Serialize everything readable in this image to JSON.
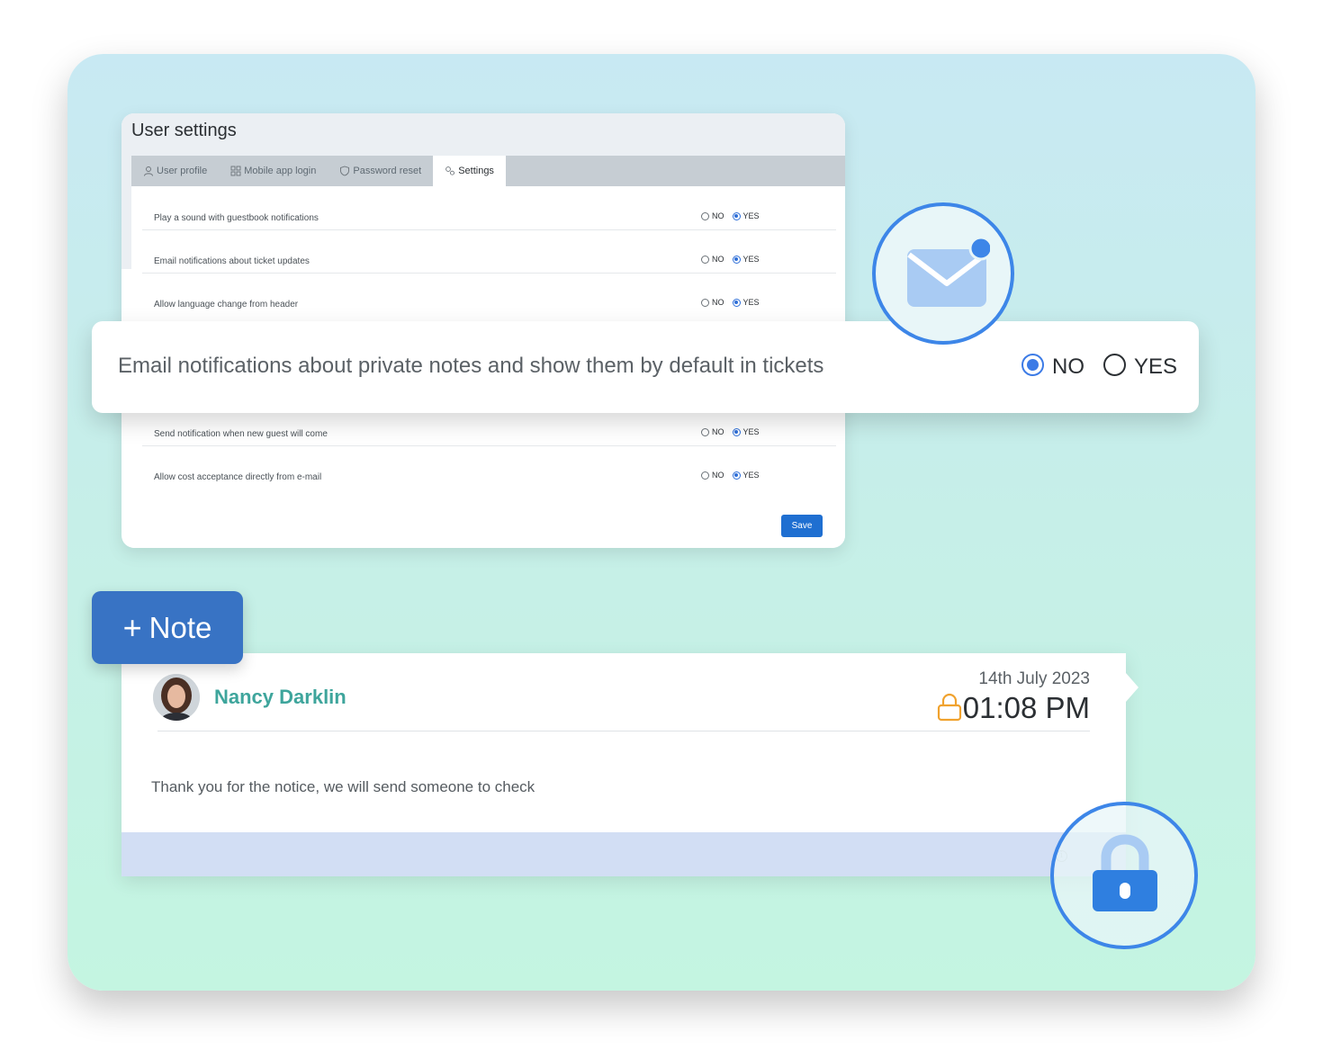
{
  "settings": {
    "title": "User settings",
    "tabs": [
      {
        "label": "User profile",
        "icon": "user-icon"
      },
      {
        "label": "Mobile app login",
        "icon": "qr-icon"
      },
      {
        "label": "Password reset",
        "icon": "shield-icon"
      },
      {
        "label": "Settings",
        "icon": "gears-icon",
        "active": true
      }
    ],
    "rows": [
      {
        "label": "Play a sound with guestbook notifications",
        "selected": "YES"
      },
      {
        "label": "Email notifications about ticket updates",
        "selected": "YES"
      },
      {
        "label": "Allow language change from header",
        "selected": "YES"
      },
      {
        "label": "Send notification when new guest will come",
        "selected": "YES"
      },
      {
        "label": "Allow cost acceptance directly from e-mail",
        "selected": "YES"
      }
    ],
    "no_label": "NO",
    "yes_label": "YES",
    "save_label": "Save"
  },
  "highlight": {
    "label": "Email notifications about private notes and show them by default in tickets",
    "selected": "NO",
    "no_label": "NO",
    "yes_label": "YES"
  },
  "note_button": {
    "plus": "+",
    "label": "Note"
  },
  "note": {
    "author": "Nancy Darklin",
    "date": "14th July 2023",
    "time": "01:08 PM",
    "text": "Thank you for the notice, we will send someone to check"
  },
  "colors": {
    "accent": "#3d86e8",
    "save_button": "#1f6fd1",
    "note_button": "#3873c4",
    "author_name": "#3ea59c",
    "lock_outline": "#f0a22e"
  }
}
